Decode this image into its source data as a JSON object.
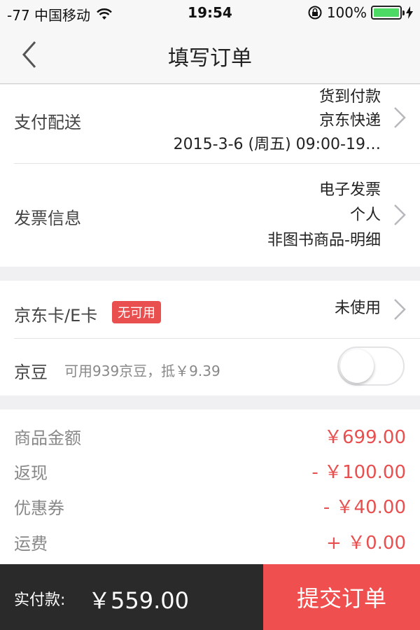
{
  "status_bar": {
    "carrier": "-77 中国移动",
    "time": "19:54",
    "battery": "100%"
  },
  "nav": {
    "title": "填写订单"
  },
  "payment_delivery": {
    "label": "支付配送",
    "line1": "货到付款",
    "line2": "京东快递",
    "line3": "2015-3-6  (周五)  09:00-19…"
  },
  "invoice": {
    "label": "发票信息",
    "line1": "电子发票",
    "line2": "个人",
    "line3": "非图书商品-明细"
  },
  "jd_card": {
    "label": "京东卡/E卡",
    "badge": "无可用",
    "value": "未使用"
  },
  "jd_beans": {
    "label": "京豆",
    "hint": "可用939京豆，抵￥9.39",
    "enabled": false
  },
  "summary": [
    {
      "label": "商品金额",
      "value": "￥699.00"
    },
    {
      "label": "返现",
      "value": "-  ￥100.00"
    },
    {
      "label": "优惠券",
      "value": "-  ￥40.00"
    },
    {
      "label": "运费",
      "value": "+  ￥0.00"
    }
  ],
  "footer": {
    "pay_label": "实付款:",
    "pay_amount": "￥559.00",
    "submit_label": "提交订单"
  },
  "colors": {
    "accent": "#ef4f4f",
    "dark_bar": "#2a2a2a",
    "battery": "#4cd964"
  }
}
